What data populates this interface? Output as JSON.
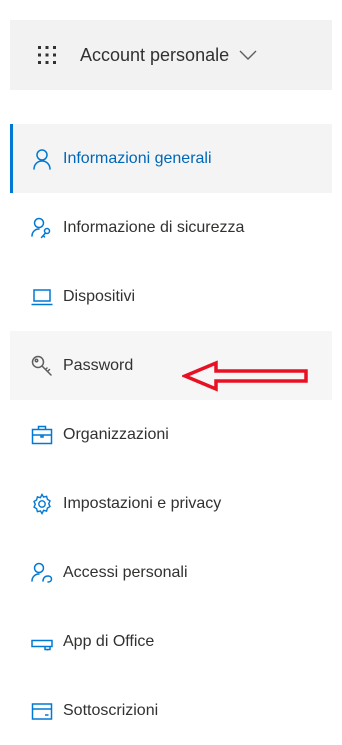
{
  "header": {
    "title": "Account personale",
    "waffle_icon": "waffle-icon",
    "chevron_icon": "chevron-down-icon"
  },
  "nav": {
    "items": [
      {
        "label": "Informazioni generali",
        "icon": "person-icon",
        "active": true
      },
      {
        "label": "Informazione di sicurezza",
        "icon": "person-key-icon"
      },
      {
        "label": "Dispositivi",
        "icon": "laptop-icon"
      },
      {
        "label": "Password",
        "icon": "key-icon"
      },
      {
        "label": "Organizzazioni",
        "icon": "briefcase-icon"
      },
      {
        "label": "Impostazioni e privacy",
        "icon": "gear-icon"
      },
      {
        "label": "Accessi personali",
        "icon": "person-sign-in-icon"
      },
      {
        "label": "App di Office",
        "icon": "office-apps-icon"
      },
      {
        "label": "Sottoscrizioni",
        "icon": "subscription-card-icon"
      }
    ]
  },
  "annotation": {
    "arrow_color": "#e81123",
    "points_to": "Password"
  },
  "colors": {
    "accent": "#0078d4",
    "active_text": "#0067b8",
    "text": "#323130",
    "header_bg": "#f2f2f2"
  }
}
